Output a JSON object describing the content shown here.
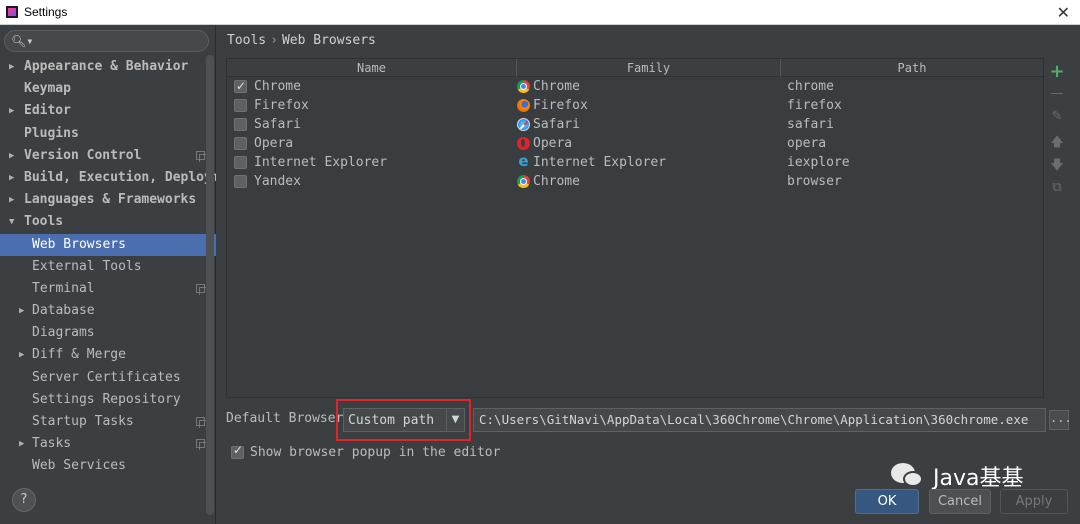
{
  "window": {
    "title": "Settings"
  },
  "search": {
    "icon": "search-icon"
  },
  "sidebar": {
    "items": [
      {
        "label": "Appearance & Behavior",
        "level": "top",
        "arrow": true
      },
      {
        "label": "Keymap",
        "level": "top",
        "arrow": false
      },
      {
        "label": "Editor",
        "level": "top",
        "arrow": true
      },
      {
        "label": "Plugins",
        "level": "top",
        "arrow": false
      },
      {
        "label": "Version Control",
        "level": "top",
        "arrow": true,
        "copy": true
      },
      {
        "label": "Build, Execution, Deployment",
        "level": "top",
        "arrow": true
      },
      {
        "label": "Languages & Frameworks",
        "level": "top",
        "arrow": true
      },
      {
        "label": "Tools",
        "level": "top",
        "arrow": "down"
      },
      {
        "label": "Web Browsers",
        "level": "sub",
        "selected": true
      },
      {
        "label": "External Tools",
        "level": "sub"
      },
      {
        "label": "Terminal",
        "level": "sub",
        "copy": true
      },
      {
        "label": "Database",
        "level": "sub",
        "arrow": true
      },
      {
        "label": "Diagrams",
        "level": "sub"
      },
      {
        "label": "Diff & Merge",
        "level": "sub",
        "arrow": true
      },
      {
        "label": "Server Certificates",
        "level": "sub"
      },
      {
        "label": "Settings Repository",
        "level": "sub"
      },
      {
        "label": "Startup Tasks",
        "level": "sub",
        "copy": true
      },
      {
        "label": "Tasks",
        "level": "sub",
        "arrow": true,
        "copy": true
      },
      {
        "label": "Web Services",
        "level": "sub"
      }
    ]
  },
  "breadcrumb": {
    "parent": "Tools",
    "separator": "›",
    "current": "Web Browsers"
  },
  "table": {
    "columns": [
      "Name",
      "Family",
      "Path"
    ],
    "rows": [
      {
        "checked": true,
        "name": "Chrome",
        "family": "Chrome",
        "family_icon": "chrome",
        "path": "chrome"
      },
      {
        "checked": false,
        "name": "Firefox",
        "family": "Firefox",
        "family_icon": "firefox",
        "path": "firefox"
      },
      {
        "checked": false,
        "name": "Safari",
        "family": "Safari",
        "family_icon": "safari",
        "path": "safari"
      },
      {
        "checked": false,
        "name": "Opera",
        "family": "Opera",
        "family_icon": "opera",
        "path": "opera"
      },
      {
        "checked": false,
        "name": "Internet Explorer",
        "family": "Internet Explorer",
        "family_icon": "ie",
        "path": "iexplore"
      },
      {
        "checked": false,
        "name": "Yandex",
        "family": "Chrome",
        "family_icon": "chrome",
        "path": "browser"
      }
    ]
  },
  "actions": [
    "add-icon",
    "remove-icon",
    "edit-icon",
    "move-up-icon",
    "move-down-icon",
    "copy-icon"
  ],
  "default_browser": {
    "label": "Default Browser:",
    "selected": "Custom path",
    "path": "C:\\Users\\GitNavi\\AppData\\Local\\360Chrome\\Chrome\\Application\\360chrome.exe",
    "browse_label": "..."
  },
  "popup": {
    "checked": true,
    "label": "Show browser popup in the editor"
  },
  "watermark": {
    "text": "Java基基"
  },
  "buttons": {
    "ok": "OK",
    "cancel": "Cancel",
    "apply": "Apply"
  },
  "help": "?",
  "colors": {
    "selection": "#4b6eaf",
    "highlight_box": "#e0242c",
    "ok_button": "#365880",
    "add_icon": "#59a869"
  }
}
